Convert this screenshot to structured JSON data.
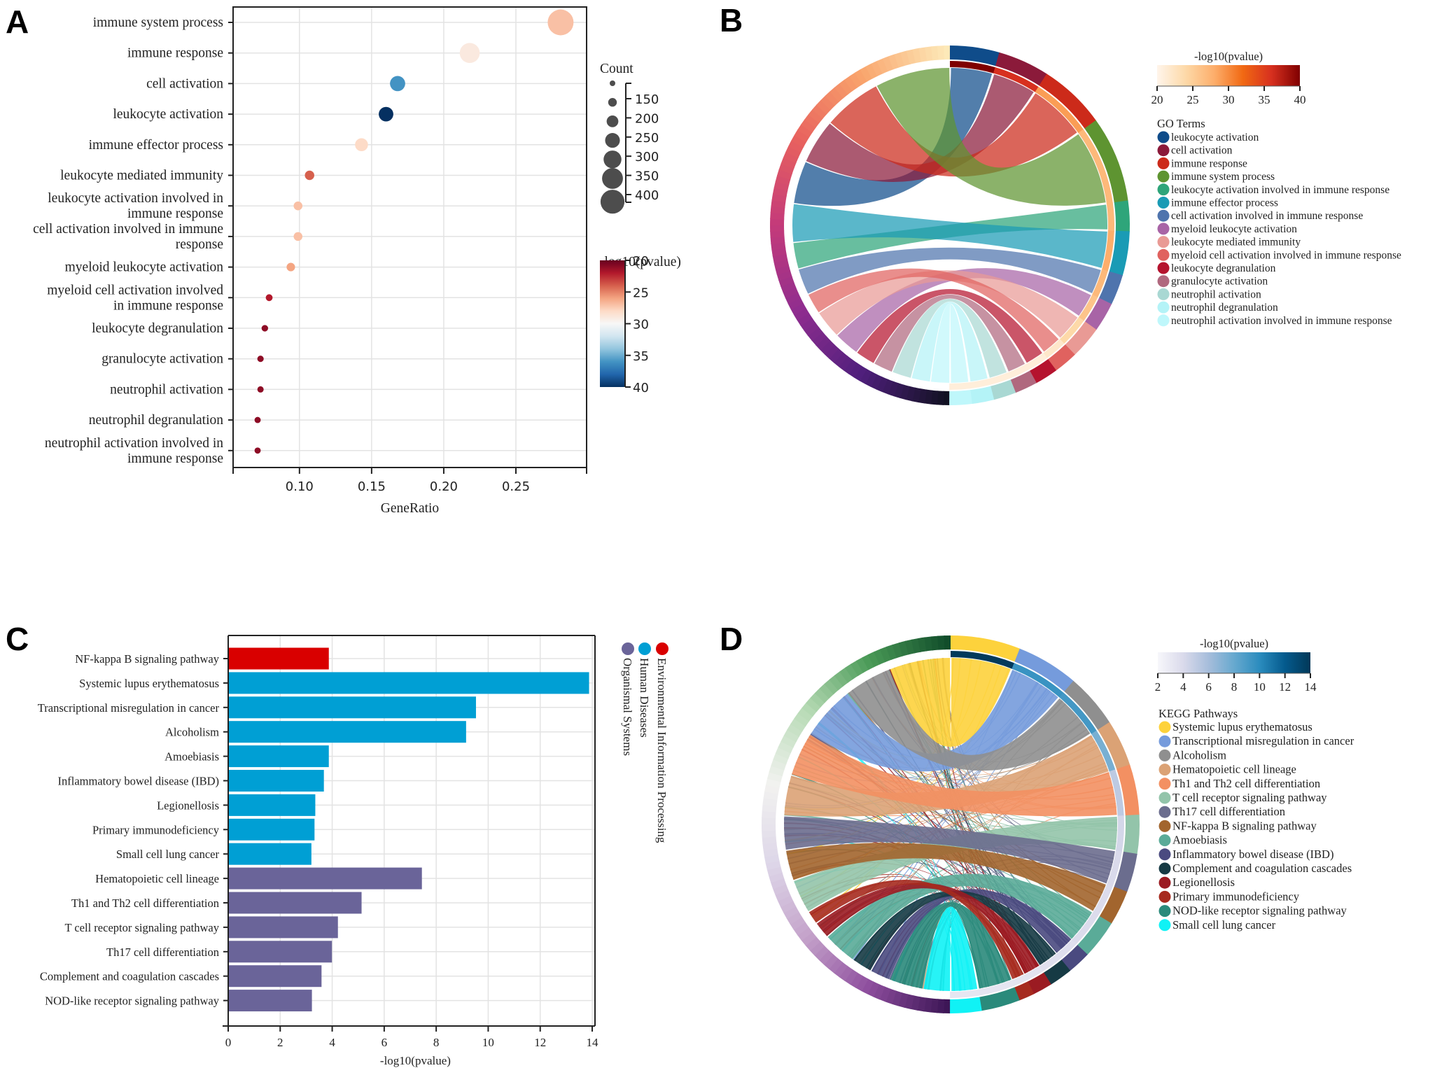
{
  "panels": {
    "A": {
      "letter": "A"
    },
    "B": {
      "letter": "B"
    },
    "C": {
      "letter": "C"
    },
    "D": {
      "letter": "D"
    }
  },
  "chart_data": [
    {
      "id": "A",
      "type": "scatter",
      "subtype": "bubble",
      "title": "",
      "xlabel": "GeneRatio",
      "ylabel": "",
      "xlim": [
        0.054,
        0.299
      ],
      "xticks": [
        0.1,
        0.15,
        0.2,
        0.25
      ],
      "xtick_labels": [
        "0.10",
        "0.15",
        "0.20",
        "0.25"
      ],
      "grid": true,
      "categories": [
        "immune system process",
        "immune response",
        "cell activation",
        "leukocyte activation",
        "immune effector process",
        "leukocyte mediated immunity",
        "leukocyte activation involved in immune response",
        "cell activation involved in immune response",
        "myeloid leukocyte activation",
        "myeloid cell activation involved in immune response",
        "leukocyte degranulation",
        "granulocyte activation",
        "neutrophil activation",
        "neutrophil degranulation",
        "neutrophil activation involved in immune response"
      ],
      "category_label_lines": [
        [
          "immune system process"
        ],
        [
          "immune response"
        ],
        [
          "cell activation"
        ],
        [
          "leukocyte activation"
        ],
        [
          "immune effector process"
        ],
        [
          "leukocyte mediated immunity"
        ],
        [
          "leukocyte activation involved in",
          "immune response"
        ],
        [
          "cell activation involved in immune",
          "response"
        ],
        [
          "myeloid leukocyte activation"
        ],
        [
          "myeloid cell activation involved",
          "in immune response"
        ],
        [
          "leukocyte degranulation"
        ],
        [
          "granulocyte activation"
        ],
        [
          "neutrophil activation"
        ],
        [
          "neutrophil degranulation"
        ],
        [
          "neutrophil activation involved in",
          "immune response"
        ]
      ],
      "gene_ratio": [
        0.281,
        0.218,
        0.168,
        0.16,
        0.143,
        0.107,
        0.099,
        0.099,
        0.094,
        0.079,
        0.076,
        0.073,
        0.073,
        0.071,
        0.071
      ],
      "count": [
        410,
        320,
        245,
        235,
        210,
        155,
        145,
        145,
        140,
        115,
        110,
        108,
        107,
        105,
        105
      ],
      "neg_log10_pvalue": [
        27,
        29,
        36,
        40,
        28,
        24,
        27,
        27,
        26,
        22,
        21,
        21,
        21,
        21,
        21
      ],
      "legend": {
        "size_title": "Count",
        "size_ticks": [
          150,
          200,
          250,
          300,
          350,
          400
        ],
        "color_title": "-log10(pvalue)",
        "color_ticks": [
          20,
          25,
          30,
          35,
          40
        ],
        "color_range": [
          20,
          40
        ],
        "colormap": [
          "#67001f",
          "#b2182b",
          "#d6604d",
          "#f4a582",
          "#fddbc7",
          "#f7f7f7",
          "#d1e5f0",
          "#92c5de",
          "#4393c3",
          "#2166ac",
          "#053061"
        ],
        "placement": "right"
      }
    },
    {
      "id": "B",
      "type": "chord",
      "legend_title": "GO Terms",
      "colorbar": {
        "title": "-log10(pvalue)",
        "ticks": [
          20,
          25,
          30,
          35,
          40
        ],
        "range": [
          20,
          40
        ],
        "colormap": [
          "#fff5eb",
          "#fdd9a8",
          "#fdae6b",
          "#f16913",
          "#d7301f",
          "#7f0000"
        ]
      },
      "terms": [
        {
          "name": "leukocyte activation",
          "color": "#0f4c8a",
          "count": 235,
          "neg_log10_pvalue": 40
        },
        {
          "name": "cell activation",
          "color": "#8b1a3a",
          "count": 245,
          "neg_log10_pvalue": 36
        },
        {
          "name": "immune response",
          "color": "#cc2a1a",
          "count": 320,
          "neg_log10_pvalue": 29
        },
        {
          "name": "immune system process",
          "color": "#5e9431",
          "count": 410,
          "neg_log10_pvalue": 27
        },
        {
          "name": "leukocyte activation involved in immune response",
          "color": "#2ea57a",
          "count": 145,
          "neg_log10_pvalue": 27
        },
        {
          "name": "immune effector process",
          "color": "#1a9bb5",
          "count": 210,
          "neg_log10_pvalue": 28
        },
        {
          "name": "cell activation involved in immune response",
          "color": "#4f74ad",
          "count": 145,
          "neg_log10_pvalue": 27
        },
        {
          "name": "myeloid leukocyte activation",
          "color": "#a864a6",
          "count": 140,
          "neg_log10_pvalue": 26
        },
        {
          "name": "leukocyte mediated immunity",
          "color": "#e99a95",
          "count": 155,
          "neg_log10_pvalue": 24
        },
        {
          "name": "myeloid cell activation involved in immune response",
          "color": "#e0625f",
          "count": 115,
          "neg_log10_pvalue": 22
        },
        {
          "name": "leukocyte degranulation",
          "color": "#b5132e",
          "count": 110,
          "neg_log10_pvalue": 21
        },
        {
          "name": "granulocyte activation",
          "color": "#b0687e",
          "count": 108,
          "neg_log10_pvalue": 21
        },
        {
          "name": "neutrophil activation",
          "color": "#a9d8d3",
          "count": 107,
          "neg_log10_pvalue": 21
        },
        {
          "name": "neutrophil degranulation",
          "color": "#b4f3f7",
          "count": 105,
          "neg_log10_pvalue": 21
        },
        {
          "name": "neutrophil activation involved in immune response",
          "color": "#bff7fb",
          "count": 105,
          "neg_log10_pvalue": 21
        }
      ],
      "gene_ring_gradient": [
        "#fde9b8",
        "#f9a46c",
        "#e8625e",
        "#c43a7a",
        "#8f2d8f",
        "#4f1f7c",
        "#111122"
      ]
    },
    {
      "id": "C",
      "type": "bar",
      "orientation": "horizontal",
      "xlabel": "-log10(pvalue)",
      "ylabel": "",
      "xlim": [
        0,
        14.2
      ],
      "xticks": [
        0,
        2,
        4,
        6,
        8,
        10,
        12,
        14
      ],
      "grid": true,
      "categories": [
        "NF-kappa B signaling pathway",
        "Systemic lupus erythematosus",
        "Transcriptional misregulation in cancer",
        "Alcoholism",
        "Amoebiasis",
        "Inflammatory bowel disease (IBD)",
        "Legionellosis",
        "Primary immunodeficiency",
        "Small cell lung cancer",
        "Hematopoietic cell lineage",
        "Th1 and Th2 cell differentiation",
        "T cell receptor signaling pathway",
        "Th17 cell differentiation",
        "Complement and coagulation cascades",
        "NOD-like receptor signaling pathway"
      ],
      "values": [
        3.87,
        13.88,
        9.53,
        9.15,
        3.87,
        3.68,
        3.35,
        3.32,
        3.2,
        7.45,
        5.13,
        4.22,
        3.99,
        3.59,
        3.22
      ],
      "groups": [
        "Environmental Information Processing",
        "Human Diseases",
        "Human Diseases",
        "Human Diseases",
        "Human Diseases",
        "Human Diseases",
        "Human Diseases",
        "Human Diseases",
        "Human Diseases",
        "Organismal Systems",
        "Organismal Systems",
        "Organismal Systems",
        "Organismal Systems",
        "Organismal Systems",
        "Organismal Systems"
      ],
      "legend": [
        {
          "name": "Environmental Information Processing",
          "color": "#d90000"
        },
        {
          "name": "Human Diseases",
          "color": "#009fd4"
        },
        {
          "name": "Organismal Systems",
          "color": "#6a6499"
        }
      ],
      "legend_placement": "right (rotated)"
    },
    {
      "id": "D",
      "type": "chord",
      "legend_title": "KEGG Pathways",
      "colorbar": {
        "title": "-log10(pvalue)",
        "ticks": [
          2,
          4,
          6,
          8,
          10,
          12,
          14
        ],
        "range": [
          2,
          14
        ],
        "colormap": [
          "#f7f7fb",
          "#dadaeb",
          "#a6bddb",
          "#67a9cf",
          "#2b8cbe",
          "#045a8d",
          "#023858"
        ]
      },
      "terms": [
        {
          "name": "Systemic lupus erythematosus",
          "color": "#fdd23c",
          "neg_log10_pvalue": 13.88
        },
        {
          "name": "Transcriptional misregulation in cancer",
          "color": "#759bdc",
          "neg_log10_pvalue": 9.53
        },
        {
          "name": "Alcoholism",
          "color": "#8f8f8f",
          "neg_log10_pvalue": 9.15
        },
        {
          "name": "Hematopoietic cell lineage",
          "color": "#dba275",
          "neg_log10_pvalue": 7.45
        },
        {
          "name": "Th1 and Th2 cell differentiation",
          "color": "#f39062",
          "neg_log10_pvalue": 5.13
        },
        {
          "name": "T cell receptor signaling pathway",
          "color": "#93c4aa",
          "neg_log10_pvalue": 4.22
        },
        {
          "name": "Th17 cell differentiation",
          "color": "#6b6d8e",
          "neg_log10_pvalue": 3.99
        },
        {
          "name": "NF-kappa B signaling pathway",
          "color": "#a2652e",
          "neg_log10_pvalue": 3.87
        },
        {
          "name": "Amoebiasis",
          "color": "#5aab98",
          "neg_log10_pvalue": 3.87
        },
        {
          "name": "Inflammatory bowel disease (IBD)",
          "color": "#4a4a80",
          "neg_log10_pvalue": 3.68
        },
        {
          "name": "Complement and coagulation cascades",
          "color": "#163a44",
          "neg_log10_pvalue": 3.59
        },
        {
          "name": "Legionellosis",
          "color": "#9b1b22",
          "neg_log10_pvalue": 3.35
        },
        {
          "name": "Primary immunodeficiency",
          "color": "#a62a1e",
          "neg_log10_pvalue": 3.32
        },
        {
          "name": "NOD-like receptor signaling pathway",
          "color": "#2a8a7b",
          "neg_log10_pvalue": 3.22
        },
        {
          "name": "Small cell lung cancer",
          "color": "#10f2f5",
          "neg_log10_pvalue": 3.2
        }
      ],
      "gene_ring_gradient": [
        "#114d2a",
        "#4a9a57",
        "#b8dbb6",
        "#f2f2f0",
        "#ddd6e8",
        "#c4a2ca",
        "#8d4d9d",
        "#3d1656"
      ]
    }
  ]
}
